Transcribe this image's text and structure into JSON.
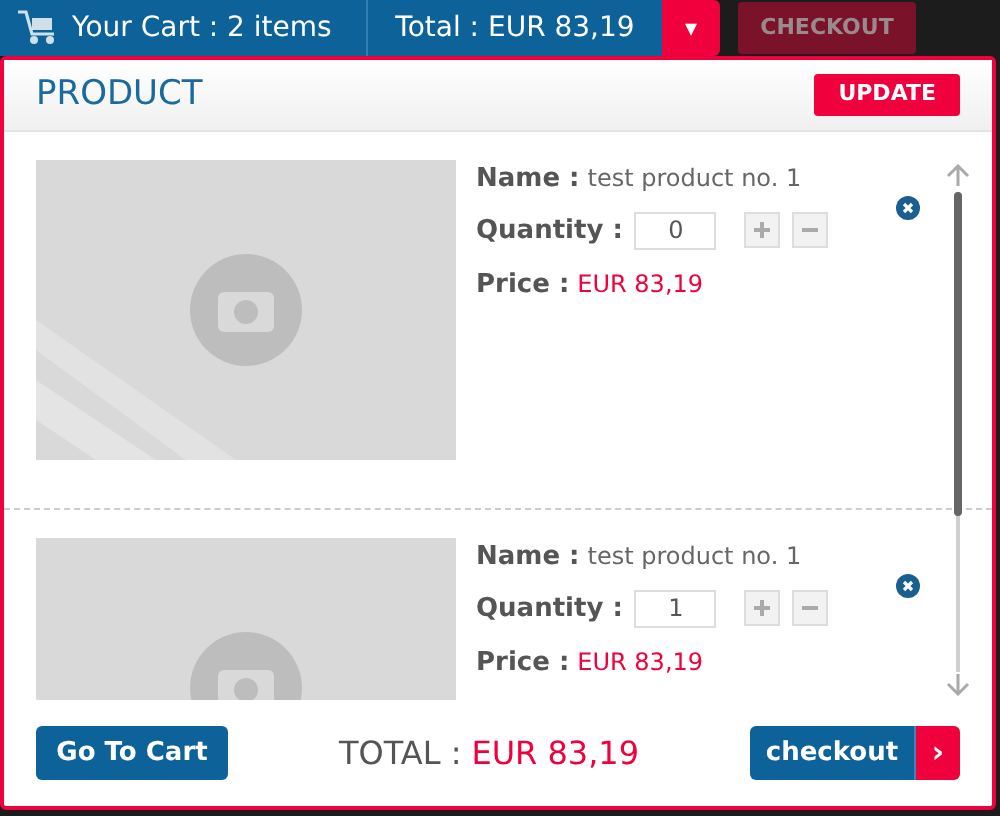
{
  "top_bar": {
    "cart_label": "Your Cart : 2 items",
    "total_label": "Total : EUR 83,19",
    "dropdown_icon": "▾",
    "checkout": {
      "label": "CHECKOUT",
      "disabled": true
    }
  },
  "panel": {
    "title": "PRODUCT",
    "update_button": "UPDATE",
    "items": [
      {
        "name_label": "Name :",
        "name": "test product no. 1",
        "quantity_label": "Quantity :",
        "quantity": "0",
        "price_label": "Price :",
        "price": "EUR 83,19"
      },
      {
        "name_label": "Name :",
        "name": "test product no. 1",
        "quantity_label": "Quantity :",
        "quantity": "1",
        "price_label": "Price :",
        "price": "EUR 83,19"
      }
    ],
    "footer": {
      "go_to_cart": "Go To Cart",
      "total_label": "TOTAL :",
      "total": "EUR 83,19",
      "checkout": "checkout",
      "checkout_arrow": "›"
    }
  }
}
